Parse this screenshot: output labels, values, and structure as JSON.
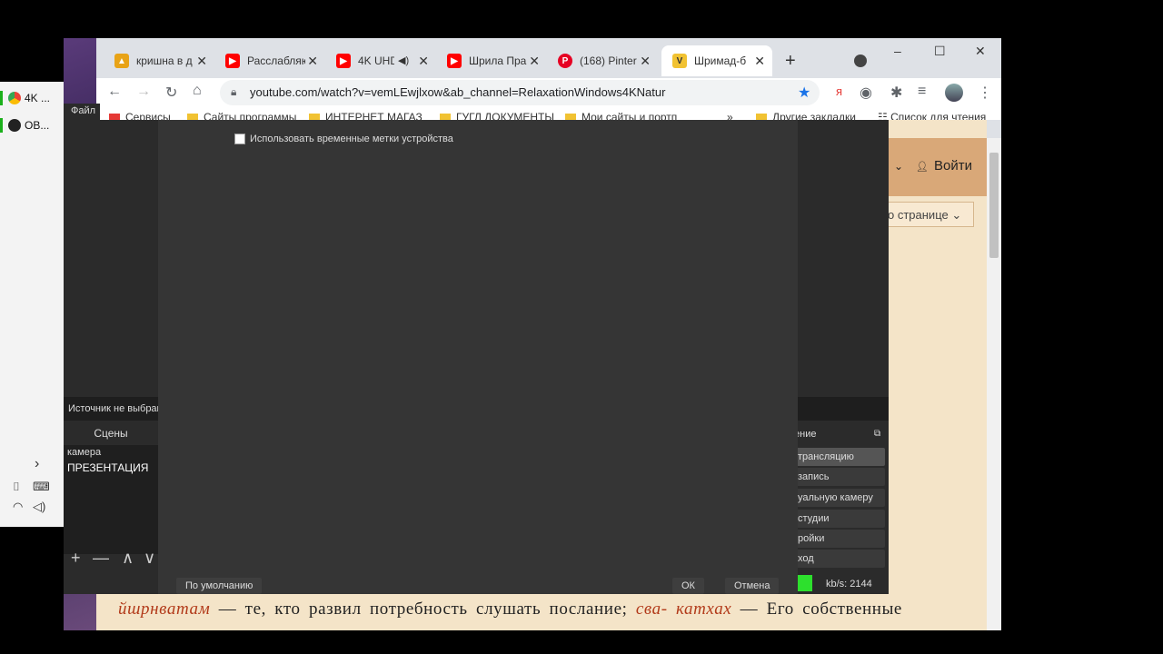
{
  "taskbar": {
    "items": [
      {
        "label": "4K ...",
        "icon": "chrome-icon",
        "color": "#4285f4"
      },
      {
        "label": "OB...",
        "icon": "obs-icon",
        "color": "#222222"
      }
    ],
    "tray": {
      "chevron": "›",
      "cam": "⌷",
      "keyboard": "⌨",
      "wifi": "◠",
      "volume": "◁)"
    }
  },
  "browser": {
    "tabs": [
      {
        "label": "кришна в д",
        "icon": "image-icon",
        "color": "#e8a317",
        "close": "✕"
      },
      {
        "label": "Расслабляю",
        "icon": "youtube-icon",
        "color": "#ff0000",
        "close": "✕"
      },
      {
        "label": "4K UHD",
        "icon": "youtube-icon",
        "color": "#ff0000",
        "close": "✕",
        "mute": "◀)"
      },
      {
        "label": "Шрила Пра",
        "icon": "youtube-icon",
        "color": "#ff0000",
        "close": "✕"
      },
      {
        "label": "(168) Pinter",
        "icon": "pinterest-icon",
        "color": "#e60023",
        "close": "✕"
      },
      {
        "label": "Шримад-б",
        "icon": "vedabase-icon",
        "color": "#f1c232",
        "close": "✕",
        "active": true
      }
    ],
    "new_tab": "+",
    "window_controls": {
      "minimize": "–",
      "maximize": "☐",
      "close": "✕"
    },
    "url": "youtube.com/watch?v=vemLEwjlxow&ab_channel=RelaxationWindows4KNatur",
    "bookmarks": [
      {
        "label": "Сервисы"
      },
      {
        "label": "Сайты программы"
      },
      {
        "label": "ИНТЕРНЕТ МАГАЗ"
      },
      {
        "label": "ГУГЛ ДОКУМЕНТЫ"
      },
      {
        "label": "Мои сайты и портп"
      },
      {
        "label": "Другие закладки"
      }
    ],
    "bookmarks_more": "»",
    "reading_list": "Список для чтения"
  },
  "webpage": {
    "login": "Войти",
    "page_button": "о странице ⌄",
    "bottom_text": {
      "part1": "йшрнватам",
      "part2": " — те, кто развил потребность слушать послание; ",
      "part3": "сва- катхах",
      "part4": " — Его собственные"
    }
  },
  "obs": {
    "menu_file": "Файл",
    "source_status": "Источник не выбран",
    "scenes_header": "Сцены",
    "scenes": [
      "камера",
      "ПРЕЗЕНТАЦИЯ"
    ],
    "scene_controls": {
      "add": "+",
      "remove": "—",
      "up": "∧",
      "down": "∨"
    },
    "controls_header": "ение",
    "controls": [
      "трансляцию",
      "запись",
      "уальную камеру",
      "студии",
      "ройки",
      "ход"
    ],
    "kbps": "kb/s: 2144"
  },
  "dialog": {
    "checkbox_label": "Использовать временные метки устройства",
    "default_button": "По умолчанию",
    "ok_button": "ОК",
    "cancel_button": "Отмена"
  }
}
